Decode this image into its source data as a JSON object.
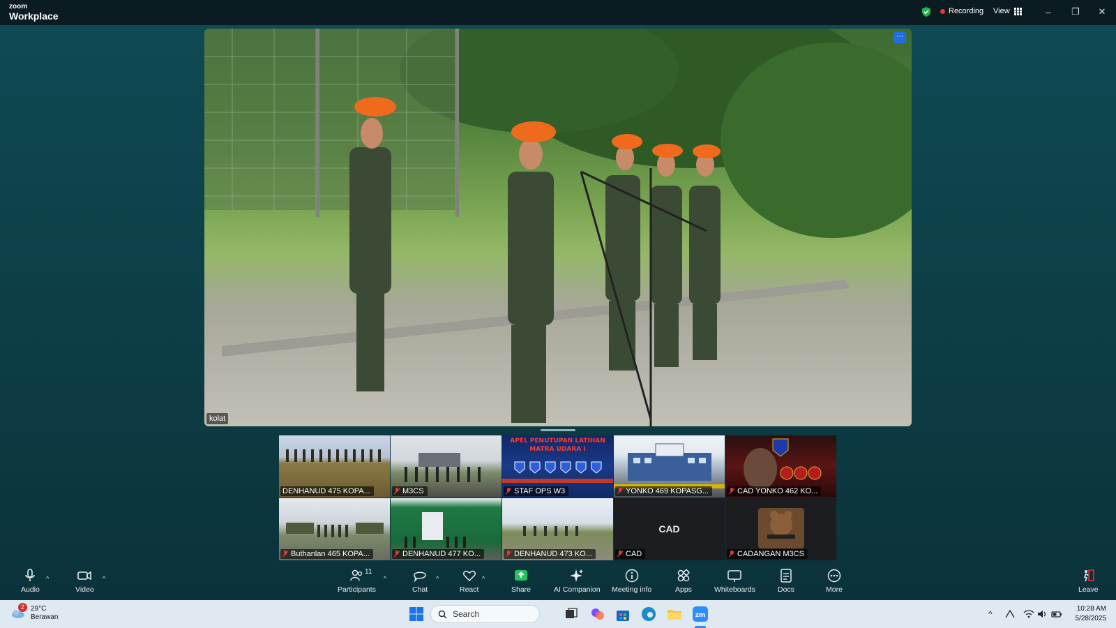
{
  "app": {
    "brand_small": "zoom",
    "brand_big": "Workplace"
  },
  "titlebar": {
    "recording": "Recording",
    "view": "View"
  },
  "main_video": {
    "label": "kolat"
  },
  "gallery": [
    {
      "name": "DENHANUD 475 KOPA...",
      "muted": false
    },
    {
      "name": "M3CS",
      "muted": true
    },
    {
      "name": "STAF OPS W3",
      "muted": true,
      "banner_line1": "APEL PENUTUPAN LATIHAN",
      "banner_line2": "MATRA UDARA I"
    },
    {
      "name": "YONKO 469 KOPASG...",
      "muted": true
    },
    {
      "name": "CAD YONKO 462 KO...",
      "muted": true
    },
    {
      "name": "Buthanlan 465 KOPA...",
      "muted": true
    },
    {
      "name": "DENHANUD 477 KO...",
      "muted": true
    },
    {
      "name": "DENHANUD 473 KO...",
      "muted": true
    },
    {
      "name": "CAD",
      "muted": true,
      "center": "CAD"
    },
    {
      "name": "CADANGAN M3CS",
      "muted": true
    }
  ],
  "toolbar": {
    "audio": "Audio",
    "video": "Video",
    "participants": "Participants",
    "participants_count": "11",
    "chat": "Chat",
    "react": "React",
    "share": "Share",
    "ai_companion": "AI Companion",
    "meeting_info": "Meeting info",
    "apps": "Apps",
    "whiteboards": "Whiteboards",
    "docs": "Docs",
    "more": "More",
    "leave": "Leave"
  },
  "taskbar": {
    "weather_temp": "29°C",
    "weather_desc": "Berawan",
    "weather_badge": "2",
    "search_placeholder": "Search",
    "time": "10:28 AM",
    "date": "5/28/2025"
  },
  "colors": {
    "accent_blue": "#1f6fe0",
    "share_green": "#21c55d",
    "rec_red": "#e53935",
    "shield_green": "#22b34a"
  }
}
